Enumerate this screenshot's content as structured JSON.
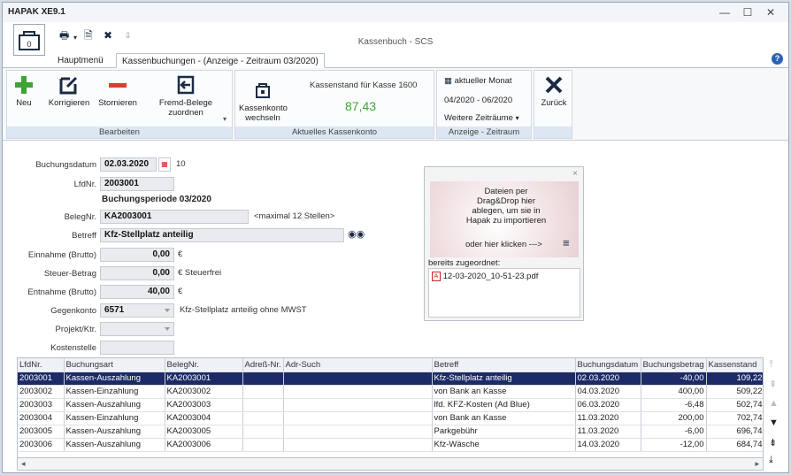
{
  "window": {
    "title": "HAPAK XE9.1",
    "app_caption": "Kassenbuch - SCS",
    "controls": {
      "minimize": "—",
      "maximize": "☐",
      "close": "✕"
    }
  },
  "qat": {
    "print_icon": "printer-icon",
    "doc_icon": "document-icon",
    "close_icon": "close-icon"
  },
  "tabs": [
    {
      "label": "Hauptmenü"
    },
    {
      "label": "Kassenbuchungen - (Anzeige - Zeitraum 03/2020)"
    }
  ],
  "ribbon": {
    "groups": {
      "bearbeiten": "Bearbeiten",
      "kassenkonto": "Aktuelles Kassenkonto",
      "zeitraum": "Anzeige - Zeitraum"
    },
    "buttons": {
      "neu": "Neu",
      "korrigieren": "Korrigieren",
      "stornieren": "Stornieren",
      "fremd_belege": "Fremd-Belege zuordnen",
      "kassenkonto_wechseln": "Kassenkonto wechseln",
      "aktueller_monat": "aktueller Monat",
      "zeitraum_range": "04/2020 - 06/2020",
      "weitere_zeitraeume": "Weitere Zeiträume",
      "zurueck": "Zurück"
    },
    "kassenstand_label": "Kassenstand für Kasse 1600",
    "kassenstand_value": "87,43",
    "colors": {
      "accent_green": "#3fa336",
      "accent_red": "#e23a2e",
      "group_label_bg": "#dde7f3"
    }
  },
  "form": {
    "buchungsdatum_label": "Buchungsdatum",
    "buchungsdatum": "02.03.2020",
    "tag_number": "10",
    "lfdnr_label": "LfdNr.",
    "lfdnr": "2003001",
    "buchungsperiode": "Buchungsperiode 03/2020",
    "belegnr_label": "BelegNr.",
    "belegnr": "KA2003001",
    "belegnr_hint": "<maximal 12 Stellen>",
    "betreff_label": "Betreff",
    "betreff": "Kfz-Stellplatz anteilig",
    "einnahme_label": "Einnahme (Brutto)",
    "einnahme": "0,00",
    "currency": "€",
    "steuer_label": "Steuer-Betrag",
    "steuer": "0,00",
    "steuer_suffix": "€ Steuerfrei",
    "entnahme_label": "Entnahme (Brutto)",
    "entnahme": "40,00",
    "gegenkonto_label": "Gegenkonto",
    "gegenkonto": "6571",
    "gegenkonto_desc": "Kfz-Stellplatz anteilig ohne MWST",
    "projekt_label": "Projekt/Ktr.",
    "kostenstelle_label": "Kostenstelle"
  },
  "dropzone": {
    "text": "Dateien per Drag&Drop hier ablegen, um sie in Hapak zu importieren",
    "click_text": "oder hier klicken --->",
    "assigned_label": "bereits zugeordnet:",
    "file_name": "12-03-2020_10-51-23.pdf"
  },
  "table": {
    "columns": [
      "LfdNr.",
      "Buchungsart",
      "BelegNr.",
      "Adreß-Nr.",
      "Adr-Such",
      "Betreff",
      "Buchungsdatum",
      "Buchungsbetrag",
      "Kassenstand"
    ],
    "rows": [
      [
        "2003001",
        "Kassen-Auszahlung",
        "KA2003001",
        "",
        "",
        "Kfz-Stellplatz anteilig",
        "02.03.2020",
        "-40,00",
        "109,22"
      ],
      [
        "2003002",
        "Kassen-Einzahlung",
        "KA2003002",
        "",
        "",
        "von Bank an Kasse",
        "04.03.2020",
        "400,00",
        "509,22"
      ],
      [
        "2003003",
        "Kassen-Auszahlung",
        "KA2003003",
        "",
        "",
        "lfd. KFZ-Kosten (Ad Blue)",
        "06.03.2020",
        "-6,48",
        "502,74"
      ],
      [
        "2003004",
        "Kassen-Einzahlung",
        "KA2003004",
        "",
        "",
        "von Bank an Kasse",
        "11.03.2020",
        "200,00",
        "702,74"
      ],
      [
        "2003005",
        "Kassen-Auszahlung",
        "KA2003005",
        "",
        "",
        "Parkgebühr",
        "11.03.2020",
        "-6,00",
        "696,74"
      ],
      [
        "2003006",
        "Kassen-Auszahlung",
        "KA2003006",
        "",
        "",
        "Kfz-Wäsche",
        "14.03.2020",
        "-12,00",
        "684,74"
      ]
    ],
    "selected_row": 0
  }
}
